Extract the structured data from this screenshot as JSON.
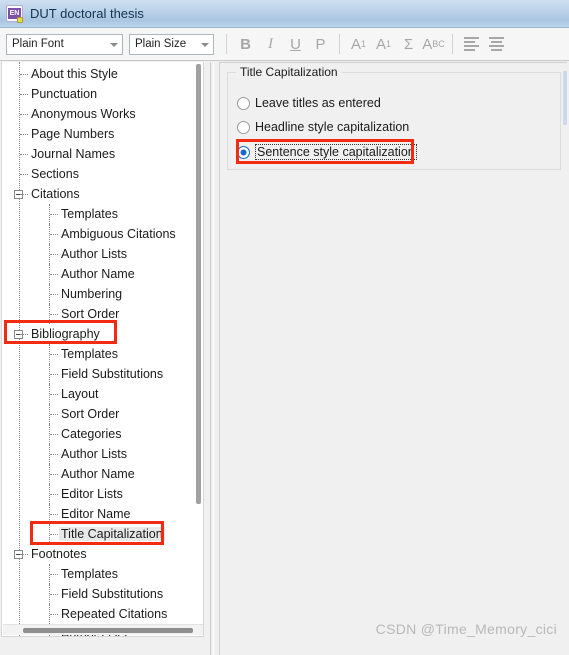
{
  "window": {
    "title": "DUT doctoral thesis",
    "app_icon": "endnote-en-icon"
  },
  "toolbar": {
    "font_combo": {
      "value": "Plain Font",
      "caret_icon": "chevron-down-icon"
    },
    "size_combo": {
      "value": "Plain Size",
      "caret_icon": "chevron-down-icon"
    },
    "buttons": [
      {
        "name": "bold",
        "label": "B"
      },
      {
        "name": "italic",
        "label": "I"
      },
      {
        "name": "underline",
        "label": "U"
      },
      {
        "name": "plain",
        "label": "P"
      },
      {
        "name": "superscript",
        "label": "A"
      },
      {
        "name": "subscript",
        "label": "A"
      },
      {
        "name": "symbol",
        "label": "Σ"
      },
      {
        "name": "abc-case",
        "label": "A"
      },
      {
        "name": "align-left",
        "label": ""
      },
      {
        "name": "align-center",
        "label": ""
      }
    ],
    "superscript_digit": "1",
    "subscript_digit": "1",
    "abc_rest": "BC"
  },
  "tree": {
    "items": [
      {
        "label": "About this Style",
        "level": 1,
        "expander": false
      },
      {
        "label": "Punctuation",
        "level": 1,
        "expander": false
      },
      {
        "label": "Anonymous Works",
        "level": 1,
        "expander": false
      },
      {
        "label": "Page Numbers",
        "level": 1,
        "expander": false
      },
      {
        "label": "Journal Names",
        "level": 1,
        "expander": false
      },
      {
        "label": "Sections",
        "level": 1,
        "expander": false
      },
      {
        "label": "Citations",
        "level": 1,
        "expander": true
      },
      {
        "label": "Templates",
        "level": 2,
        "expander": false
      },
      {
        "label": "Ambiguous Citations",
        "level": 2,
        "expander": false
      },
      {
        "label": "Author Lists",
        "level": 2,
        "expander": false
      },
      {
        "label": "Author Name",
        "level": 2,
        "expander": false
      },
      {
        "label": "Numbering",
        "level": 2,
        "expander": false
      },
      {
        "label": "Sort Order",
        "level": 2,
        "expander": false
      },
      {
        "label": "Bibliography",
        "level": 1,
        "expander": true,
        "highlight": true
      },
      {
        "label": "Templates",
        "level": 2,
        "expander": false
      },
      {
        "label": "Field Substitutions",
        "level": 2,
        "expander": false
      },
      {
        "label": "Layout",
        "level": 2,
        "expander": false
      },
      {
        "label": "Sort Order",
        "level": 2,
        "expander": false
      },
      {
        "label": "Categories",
        "level": 2,
        "expander": false
      },
      {
        "label": "Author Lists",
        "level": 2,
        "expander": false
      },
      {
        "label": "Author Name",
        "level": 2,
        "expander": false
      },
      {
        "label": "Editor Lists",
        "level": 2,
        "expander": false
      },
      {
        "label": "Editor Name",
        "level": 2,
        "expander": false
      },
      {
        "label": "Title Capitalization",
        "level": 2,
        "expander": false,
        "selected": true,
        "highlight": true
      },
      {
        "label": "Footnotes",
        "level": 1,
        "expander": true
      },
      {
        "label": "Templates",
        "level": 2,
        "expander": false
      },
      {
        "label": "Field Substitutions",
        "level": 2,
        "expander": false
      },
      {
        "label": "Repeated Citations",
        "level": 2,
        "expander": false
      },
      {
        "label": "Author Lists",
        "level": 2,
        "expander": false
      }
    ]
  },
  "panel": {
    "group_title": "Title Capitalization",
    "options": [
      {
        "label": "Leave titles as entered",
        "checked": false,
        "focused": false
      },
      {
        "label": "Headline style capitalization",
        "checked": false,
        "focused": false
      },
      {
        "label": "Sentence style capitalization",
        "checked": true,
        "focused": true
      }
    ]
  },
  "annotations": {
    "accent_color": "#f22b12",
    "boxes": [
      {
        "name": "bibliography-highlight"
      },
      {
        "name": "title-capitalization-highlight"
      },
      {
        "name": "sentence-style-option-highlight"
      }
    ]
  },
  "watermark": {
    "text": "CSDN @Time_Memory_cici"
  }
}
